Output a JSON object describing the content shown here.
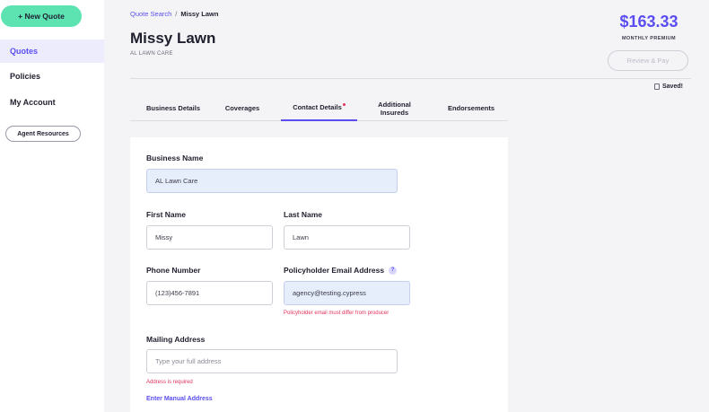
{
  "sidebar": {
    "new_quote": "+ New Quote",
    "items": [
      {
        "label": "Quotes"
      },
      {
        "label": "Policies"
      },
      {
        "label": "My Account"
      }
    ],
    "agent_resources": "Agent Resources"
  },
  "breadcrumb": {
    "parent": "Quote Search",
    "separator": "/",
    "current": "Missy Lawn"
  },
  "header": {
    "title": "Missy Lawn",
    "subtitle": "AL LAWN CARE",
    "premium_amount": "$163.33",
    "premium_label": "MONTHLY PREMIUM",
    "review_button": "Review & Pay",
    "saved_status": "Saved!"
  },
  "tabs": [
    {
      "label": "Business Details"
    },
    {
      "label": "Coverages"
    },
    {
      "label": "Contact Details"
    },
    {
      "label": "Additional Insureds"
    },
    {
      "label": "Endorsements"
    }
  ],
  "form": {
    "business_name": {
      "label": "Business Name",
      "value": "AL Lawn Care"
    },
    "first_name": {
      "label": "First Name",
      "value": "Missy"
    },
    "last_name": {
      "label": "Last Name",
      "value": "Lawn"
    },
    "phone": {
      "label": "Phone Number",
      "value": "(123)456-7891"
    },
    "email": {
      "label": "Policyholder Email Address",
      "value": "agency@testing.cypress",
      "help": "?",
      "error": "Policyholder email must differ from producer"
    },
    "mailing_address": {
      "label": "Mailing Address",
      "placeholder": "Type your full address",
      "error": "Address is required",
      "manual_link": "Enter Manual Address"
    }
  },
  "colors": {
    "accent": "#5b4ef0",
    "new_quote_bg": "#5de3b2",
    "error": "#e0325c",
    "filled_field_bg": "#e6edfb"
  }
}
